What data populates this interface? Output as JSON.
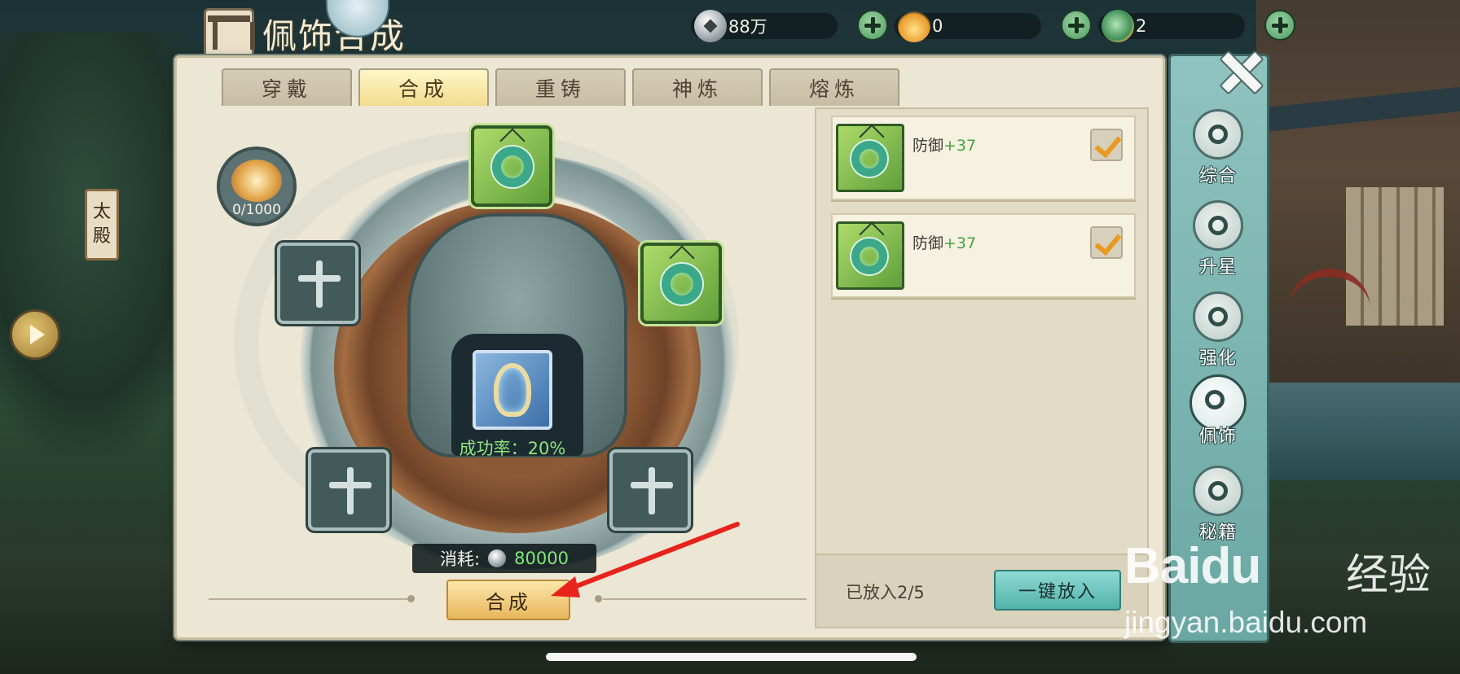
{
  "header": {
    "title": "佩饰合成",
    "currencies": [
      {
        "icon": "silver-coin-icon",
        "value": "88万"
      },
      {
        "icon": "flame-token-icon",
        "value": "0"
      },
      {
        "icon": "jade-token-icon",
        "value": "2"
      }
    ]
  },
  "side": {
    "sign_text": [
      "太",
      "殿"
    ]
  },
  "tabs": [
    {
      "label": "穿戴",
      "active": false
    },
    {
      "label": "合成",
      "active": true
    },
    {
      "label": "重铸",
      "active": false
    },
    {
      "label": "神炼",
      "active": false
    },
    {
      "label": "熔炼",
      "active": false
    }
  ],
  "synthesis": {
    "orb_count": "0/1000",
    "success_rate": "成功率：20%",
    "cost_label": "消耗:",
    "cost_value": "80000",
    "synth_button": "合成",
    "slots": [
      "filled",
      "empty",
      "filled",
      "empty",
      "empty"
    ]
  },
  "materials": {
    "items": [
      {
        "stat_name": "防御",
        "stat_value": "+37",
        "checked": true
      },
      {
        "stat_name": "防御",
        "stat_value": "+37",
        "checked": true
      }
    ],
    "placed": "已放入2/5",
    "auto_button": "一键放入"
  },
  "nav": [
    {
      "label": "综合",
      "icon": "swirl-icon",
      "active": false
    },
    {
      "label": "升星",
      "icon": "stars-icon",
      "active": false
    },
    {
      "label": "强化",
      "icon": "anvil-icon",
      "active": false
    },
    {
      "label": "佩饰",
      "icon": "pendant-icon",
      "active": true
    },
    {
      "label": "秘籍",
      "icon": "scroll-icon",
      "active": false
    }
  ],
  "watermark": {
    "brand": "Bai",
    "brand_du": "du",
    "brand_cn": "经验",
    "url": "jingyan.baidu.com"
  },
  "colors": {
    "accent_green": "#7fe77a",
    "active_tab": "#f2dc8e",
    "arrow": "#e8231c"
  }
}
